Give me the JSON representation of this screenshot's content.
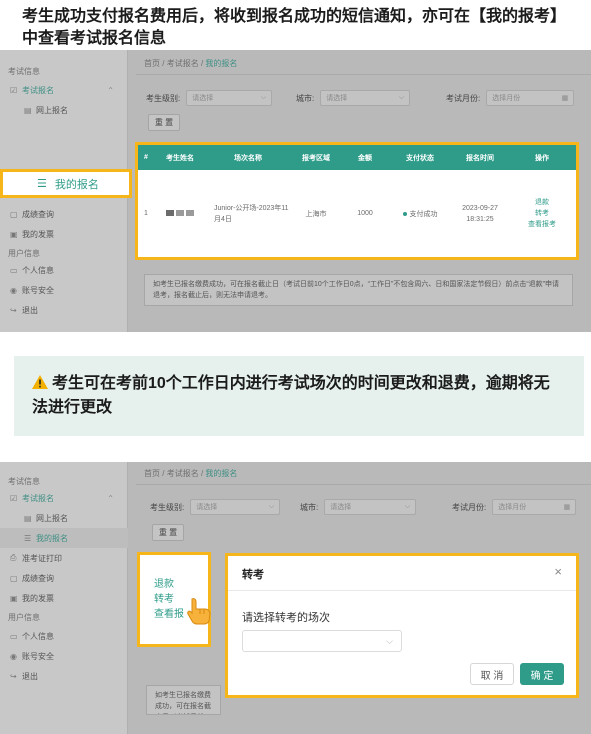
{
  "top_caption": "考生成功支付报名费用后，将收到报名成功的短信通知，亦可在【我的报考】中查看考试报名信息",
  "warning_caption": "考生可在考前10个工作日内进行考试场次的时间更改和退费，逾期将无法进行更改",
  "sidebar": {
    "group_exam": "考试信息",
    "exam_reg": "考试报名",
    "online_reg": "网上报名",
    "my_reg": "我的报名",
    "admit_print": "准考证打印",
    "score_query": "成绩查询",
    "my_invoice": "我的发票",
    "group_user": "用户信息",
    "personal_info": "个人信息",
    "account_security": "账号安全",
    "logout": "退出"
  },
  "breadcrumb": {
    "home": "首页",
    "sep": "/",
    "exam_reg": "考试报名",
    "current": "我的报名"
  },
  "filters": {
    "level_label": "考生级别:",
    "level_placeholder": "请选择",
    "city_label": "城市:",
    "city_placeholder": "请选择",
    "month_label": "考试月份:",
    "month_placeholder": "选择月份",
    "reset": "重 置"
  },
  "table": {
    "headers": [
      "#",
      "考生姓名",
      "场次名称",
      "报考区域",
      "金额",
      "支付状态",
      "报名时间",
      "操作"
    ],
    "row": {
      "index": "1",
      "session": "Junior-公开场-2023年11月4日",
      "region": "上海市",
      "amount": "1000",
      "pay_status": "支付成功",
      "time_date": "2023-09-27",
      "time_clock": "18:31:25",
      "op_refund": "退款",
      "op_transfer": "转考",
      "op_view": "查看报考"
    }
  },
  "notice": "如考生已报名缴费成功，可在报名截止日（考试日前10个工作日0点，“工作日”不包含周六、日和国家法定节假日）前点击“退款”申请退考，报名截止后，则无法申请退考。",
  "notice_short": "如考生已报名缴费成功，可在报名截止日（考试日前10个工作日0点，“工作日”不包含周六、日和国家法定节假日）前点击“退款”申请退考，报名截止后，则无法申请退考。",
  "ops_box": {
    "refund": "退款",
    "transfer": "转考",
    "view": "查看报"
  },
  "dialog": {
    "title": "转考",
    "close": "×",
    "label": "请选择转考的场次",
    "select_arrow": "⌵",
    "cancel": "取 消",
    "confirm": "确 定"
  },
  "colors": {
    "accent": "#2f9c8a",
    "highlight": "#f6b619",
    "warning_bg": "#e6f1ee"
  }
}
